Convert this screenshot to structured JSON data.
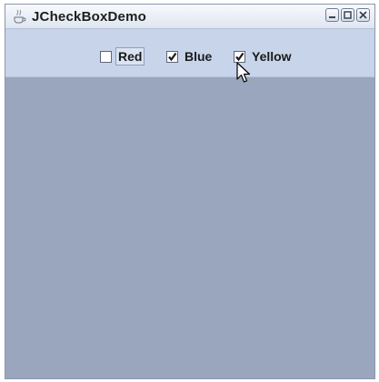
{
  "window": {
    "title": "JCheckBoxDemo",
    "icon": "java-cup-icon",
    "controls": [
      "minimize-icon",
      "maximize-icon",
      "close-icon"
    ]
  },
  "checkboxes": [
    {
      "label": "Red",
      "checked": false
    },
    {
      "label": "Blue",
      "checked": true
    },
    {
      "label": "Yellow",
      "checked": true
    }
  ],
  "colors": {
    "content_bg": "#9aa6bd",
    "toolbar_bg": "#c8d4ea",
    "titlebar_bg": "#eef2f8"
  }
}
